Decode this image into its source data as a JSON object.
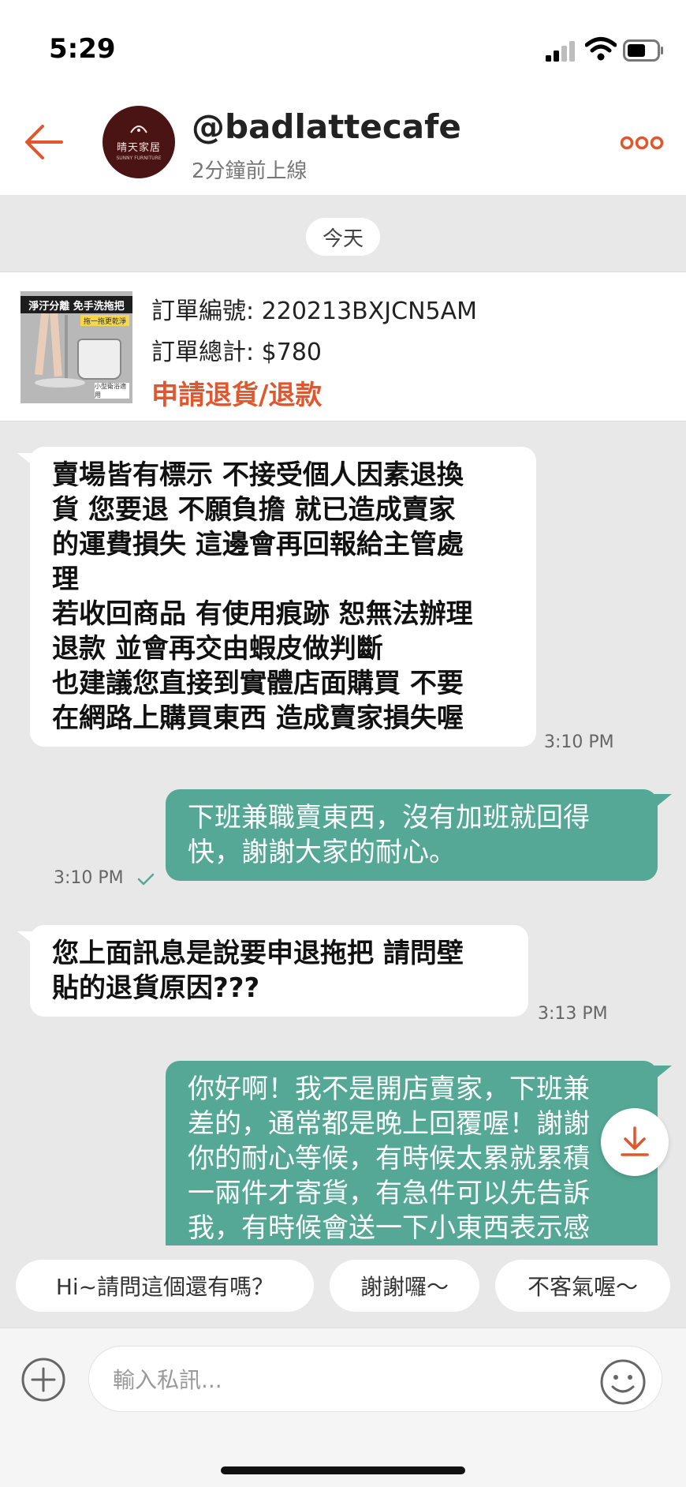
{
  "status_bar": {
    "time": "5:29"
  },
  "header": {
    "shop_name": "@badlattecafe",
    "online_status": "2分鐘前上線",
    "avatar_name": "晴天家居",
    "avatar_sub": "SUNNY FURNITURE"
  },
  "date_divider": "今天",
  "order": {
    "thumb_banner": "淨汙分離 免手洗拖把",
    "thumb_sub": "拖一拖更乾淨",
    "thumb_badge": "小型衛浴適用",
    "number": "訂單編號: 220213BXJCN5AM",
    "total": "訂單總計: $780",
    "action": "申請退貨/退款"
  },
  "messages": [
    {
      "direction": "in",
      "lines": [
        "賣場皆有標示 不接受個人因素退換",
        "貨  您要退 不願負擔 就已造成賣家",
        "的運費損失 這邊會再回報給主管處",
        "理",
        "若收回商品 有使用痕跡 恕無法辦理",
        "退款 並會再交由蝦皮做判斷",
        "也建議您直接到實體店面購買 不要",
        "在網路上購買東西 造成賣家損失喔"
      ],
      "time": "3:10 PM"
    },
    {
      "direction": "out",
      "lines": [
        "下班兼職賣東西，沒有加班就回得",
        "快，謝謝大家的耐心。"
      ],
      "time": "3:10 PM"
    },
    {
      "direction": "in",
      "lines": [
        "您上面訊息是說要申退拖把 請問壁",
        "貼的退貨原因???"
      ],
      "time": "3:13 PM"
    },
    {
      "direction": "out",
      "lines": [
        "你好啊！我不是開店賣家，下班兼",
        "差的，通常都是晚上回覆喔！謝謝",
        "你的耐心等候，有時候太累就累積",
        "一兩件才寄貨，有急件可以先告訴",
        "我，有時候會送一下小東西表示感"
      ],
      "time": ""
    }
  ],
  "quick_replies": [
    "Hi~請問這個還有嗎？",
    "謝謝囉～",
    "不客氣喔～"
  ],
  "input": {
    "placeholder": "輸入私訊..."
  },
  "icons": {
    "back": "back-arrow-icon",
    "more": "more-dots-icon",
    "scroll_down": "download-arrow-icon",
    "plus": "plus-circle-icon",
    "emoji": "smiley-icon"
  },
  "colors": {
    "accent": "#e0572d",
    "outgoing_bubble": "#55a896",
    "incoming_bubble": "#ffffff",
    "chat_background": "#e8e8e8",
    "read_check": "#55a896"
  }
}
